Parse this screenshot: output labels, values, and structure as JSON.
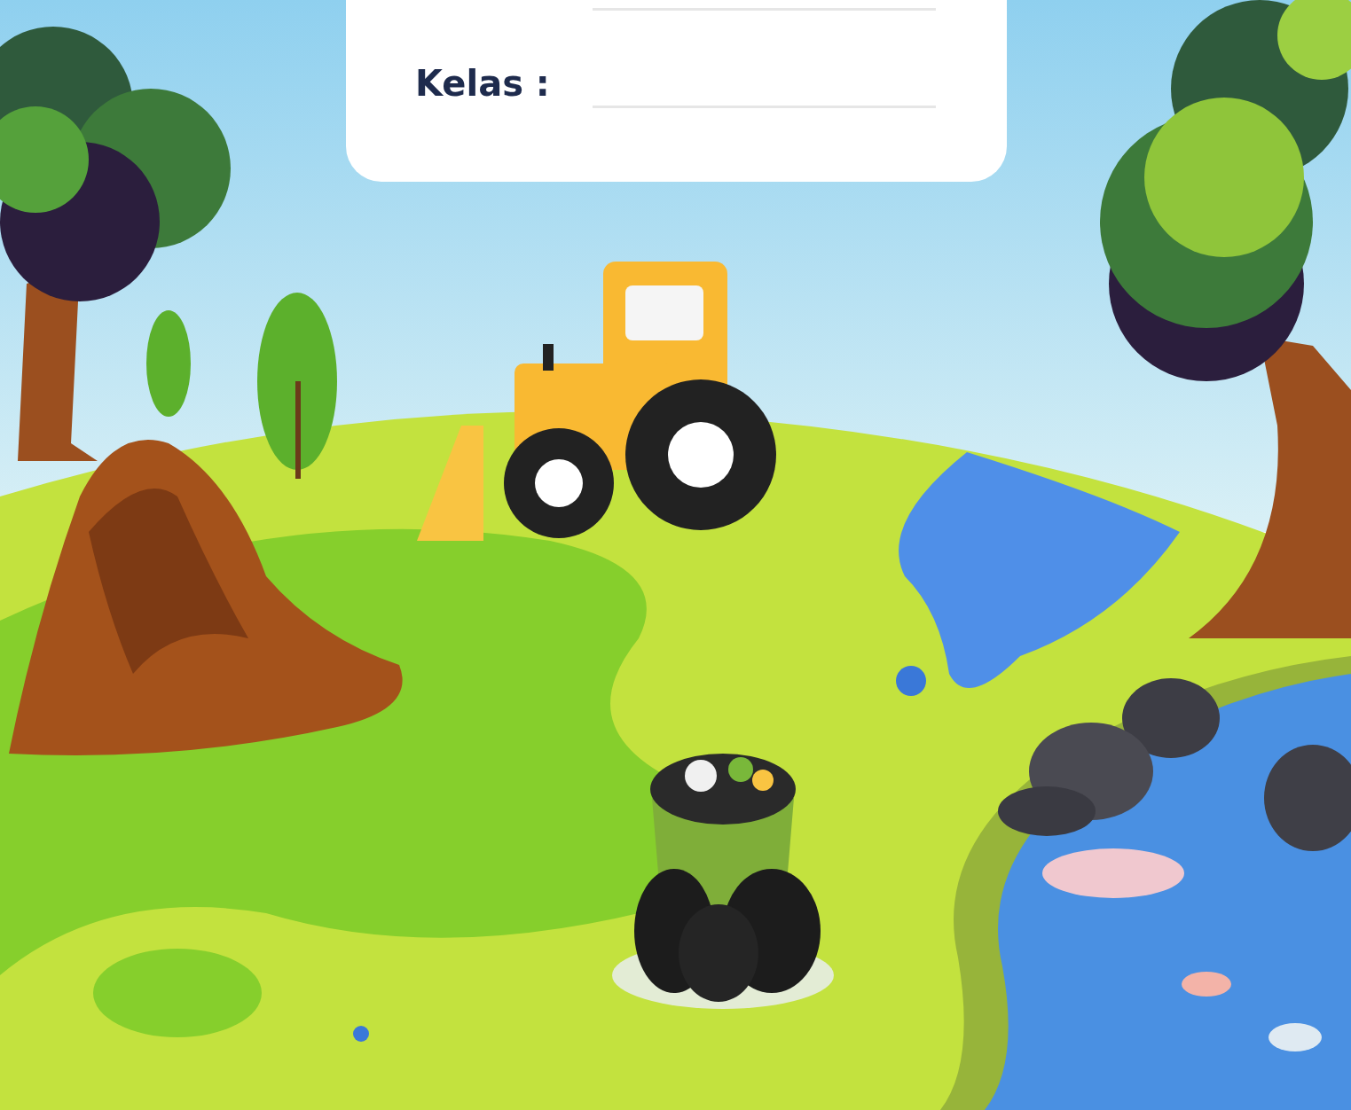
{
  "card": {
    "fields": [
      {
        "kind": "unlabeled"
      },
      {
        "kind": "labeled",
        "label": "Kelas :"
      }
    ]
  }
}
